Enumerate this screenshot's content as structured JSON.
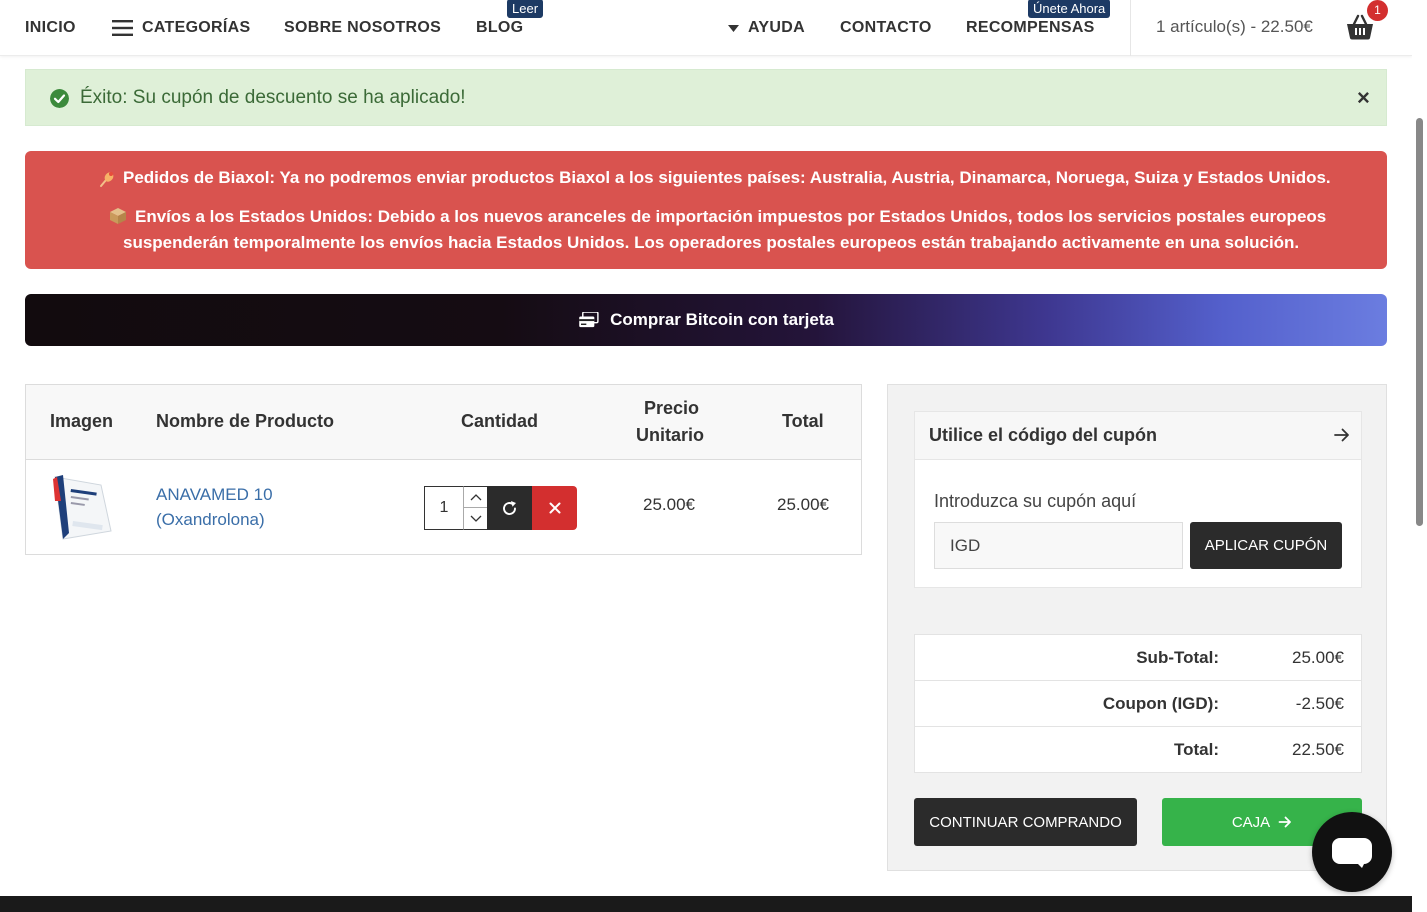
{
  "nav": {
    "inicio": "INICIO",
    "categorias": "CATEGORÍAS",
    "sobre": "SOBRE NOSOTROS",
    "blog": "BLOG",
    "blog_badge": "Leer",
    "ayuda": "AYUDA",
    "contacto": "CONTACTO",
    "recompensas": "RECOMPENSAS",
    "recompensas_badge": "Únete Ahora",
    "cart_summary": "1 artículo(s) - 22.50€",
    "cart_count": "1"
  },
  "alerts": {
    "success": "Éxito: Su cupón de descuento se ha aplicado!",
    "close": "×",
    "danger_line1": "Pedidos de Biaxol: Ya no podremos enviar productos Biaxol a los siguientes países: Australia, Austria, Dinamarca, Noruega, Suiza y Estados Unidos.",
    "danger_line2": "Envíos a los Estados Unidos: Debido a los nuevos aranceles de importación impuestos por Estados Unidos, todos los servicios postales europeos",
    "danger_line3": "suspenderán temporalmente los envíos hacia Estados Unidos. Los operadores postales europeos están trabajando activamente en una solución."
  },
  "bitcoin": {
    "label": "Comprar Bitcoin con tarjeta"
  },
  "cart": {
    "headers": {
      "imagen": "Imagen",
      "nombre": "Nombre de Producto",
      "cantidad": "Cantidad",
      "precio_1": "Precio",
      "precio_2": "Unitario",
      "total": "Total"
    },
    "items": [
      {
        "name_line1": "ANAVAMED 10",
        "name_line2": "(Oxandrolona)",
        "quantity": "1",
        "unit_price": "25.00€",
        "total": "25.00€"
      }
    ]
  },
  "coupon": {
    "title": "Utilice el código del cupón",
    "label": "Introduzca su cupón aquí",
    "value": "IGD",
    "apply": "APLICAR CUPÓN"
  },
  "totals": {
    "rows": [
      {
        "label": "Sub-Total:",
        "value": "25.00€"
      },
      {
        "label": "Coupon (IGD):",
        "value": "-2.50€"
      },
      {
        "label": "Total:",
        "value": "22.50€"
      }
    ]
  },
  "actions": {
    "continue": "CONTINUAR COMPRANDO",
    "checkout": "CAJA"
  },
  "colors": {
    "danger": "#d9534f",
    "success_bg": "#dff0d8",
    "checkout_green": "#36b34a",
    "link_blue": "#3a6ea8",
    "badge_navy": "#1d3a64"
  }
}
